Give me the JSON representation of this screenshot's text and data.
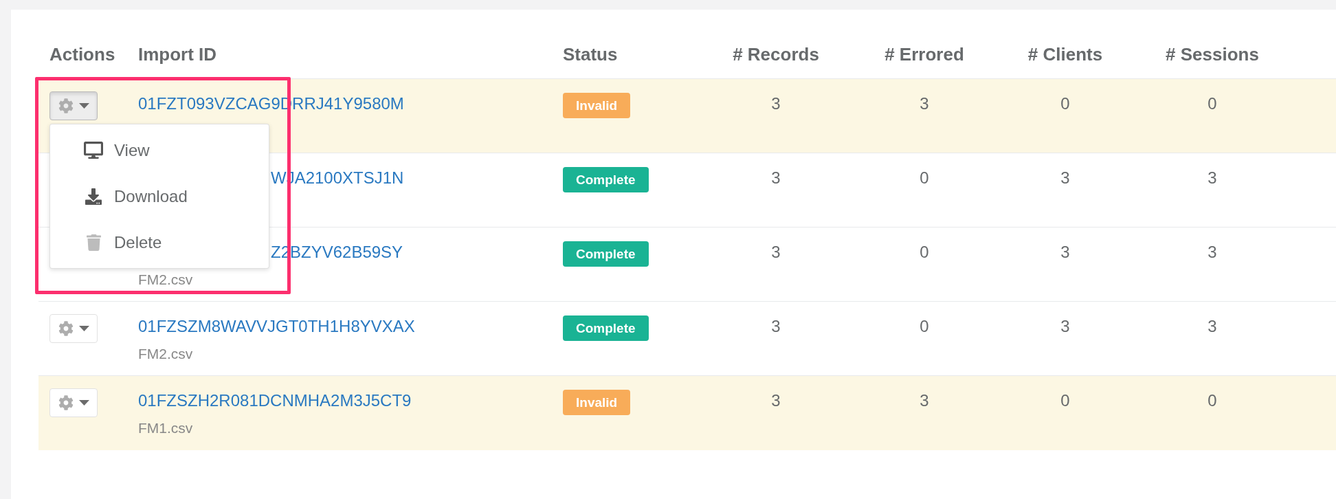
{
  "table": {
    "columns": [
      "Actions",
      "Import ID",
      "Status",
      "# Records",
      "# Errored",
      "# Clients",
      "# Sessions"
    ],
    "rows": [
      {
        "actions": {
          "open": true,
          "menu": [
            {
              "label": "View"
            },
            {
              "label": "Download"
            },
            {
              "label": "Delete"
            }
          ]
        },
        "import_id": "01FZT093VZCAG9DRRJ41Y9580M",
        "status": {
          "label": "Invalid",
          "kind": "invalid"
        },
        "records": "3",
        "errored": "3",
        "clients": "0",
        "sessions": "0"
      },
      {
        "import_id": "WJA2100XTSJ1N",
        "status": {
          "label": "Complete",
          "kind": "complete"
        },
        "records": "3",
        "errored": "0",
        "clients": "3",
        "sessions": "3"
      },
      {
        "import_id": "Z2BZYV62B59SY",
        "file_name": "FM2.csv",
        "status": {
          "label": "Complete",
          "kind": "complete"
        },
        "records": "3",
        "errored": "0",
        "clients": "3",
        "sessions": "3"
      },
      {
        "actions": {
          "open": false
        },
        "import_id": "01FZSZM8WAVVJGT0TH1H8YVXAX",
        "file_name": "FM2.csv",
        "status": {
          "label": "Complete",
          "kind": "complete"
        },
        "records": "3",
        "errored": "0",
        "clients": "3",
        "sessions": "3"
      },
      {
        "actions": {
          "open": false
        },
        "import_id": "01FZSZH2R081DCNMHA2M3J5CT9",
        "file_name": "FM1.csv",
        "status": {
          "label": "Invalid",
          "kind": "invalid"
        },
        "records": "3",
        "errored": "3",
        "clients": "0",
        "sessions": "0"
      }
    ]
  },
  "annotation": {
    "kind": "rectangle"
  }
}
